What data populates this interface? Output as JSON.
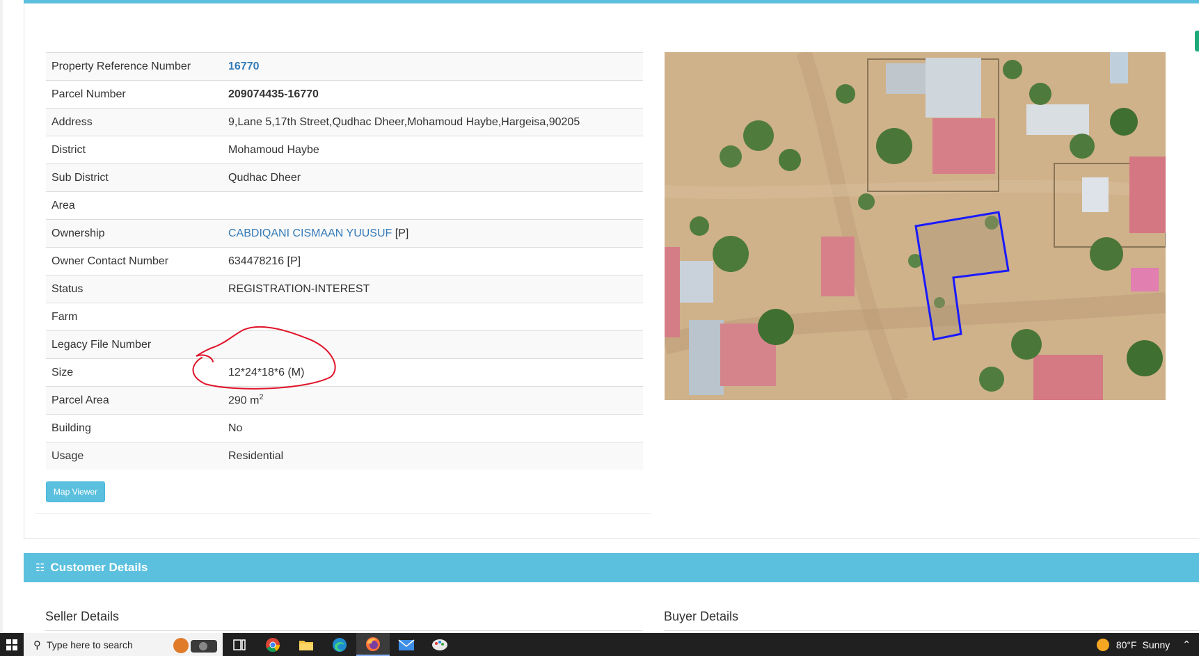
{
  "property": {
    "rows": [
      {
        "label": "Property Reference Number",
        "value": "16770"
      },
      {
        "label": "Parcel Number",
        "value": "209074435-16770"
      },
      {
        "label": "Address",
        "value": "9,Lane 5,17th Street,Qudhac Dheer,Mohamoud Haybe,Hargeisa,90205"
      },
      {
        "label": "District",
        "value": "Mohamoud Haybe"
      },
      {
        "label": "Sub District",
        "value": "Qudhac Dheer"
      },
      {
        "label": "Area",
        "value": ""
      },
      {
        "label": "Ownership",
        "value": "CABDIQANI CISMAAN YUUSUF",
        "suffix": " [P]"
      },
      {
        "label": "Owner Contact Number",
        "value": "634478216 [P]"
      },
      {
        "label": "Status",
        "value": "REGISTRATION-INTEREST"
      },
      {
        "label": "Farm",
        "value": ""
      },
      {
        "label": "Legacy File Number",
        "value": ""
      },
      {
        "label": "Size",
        "value": "12*24*18*6 (M)"
      },
      {
        "label": "Parcel Area",
        "value": "290 m",
        "sup": "2"
      },
      {
        "label": "Building",
        "value": "No"
      },
      {
        "label": "Usage",
        "value": "Residential"
      }
    ],
    "map_viewer_label": "Map Viewer"
  },
  "customer": {
    "title": "Customer Details",
    "seller_heading": "Seller Details",
    "buyer_heading": "Buyer Details"
  },
  "taskbar": {
    "search_placeholder": "Type here to search",
    "weather": "80°F",
    "weather_desc": "Sunny"
  },
  "colors": {
    "accent": "#5bc0de",
    "link": "#337ab7",
    "annotation": "#e0142a",
    "parcel_outline": "#1a1aff"
  }
}
